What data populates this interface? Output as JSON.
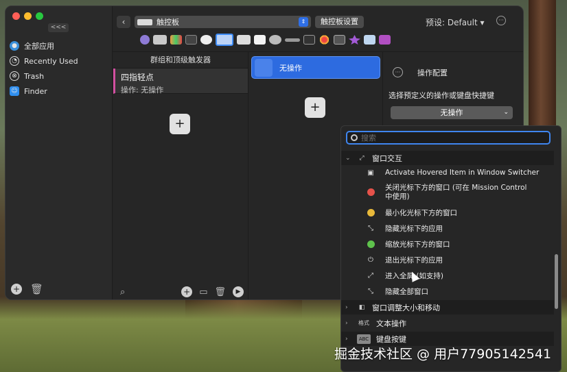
{
  "sidebar": {
    "collapse_label": "<<<",
    "items": [
      {
        "label": "全部应用",
        "icon": "globe-icon"
      },
      {
        "label": "Recently Used",
        "icon": "clock-icon"
      },
      {
        "label": "Trash",
        "icon": "trash-icon"
      },
      {
        "label": "Finder",
        "icon": "finder-icon"
      }
    ]
  },
  "toolbar": {
    "device_label": "触控板",
    "settings_label": "触控板设置",
    "preset_label": "预设: Default ▾"
  },
  "columns": {
    "triggers_header": "群组和顶级触发器",
    "trigger_title": "四指轻点",
    "trigger_subtitle": "操作: 无操作",
    "action_label": "无操作",
    "config_title": "操作配置",
    "config_subtitle": "选择预定义的操作或键盘快捷键",
    "config_select": "无操作"
  },
  "dropdown": {
    "search_placeholder": "搜索",
    "group_window_interaction": "窗口交互",
    "options": [
      {
        "label": "Activate Hovered Item in Window Switcher",
        "icon": "window-switcher-icon"
      },
      {
        "label": "关闭光标下方的窗口 (可在 Mission Control 中使用)",
        "icon": "red-dot-icon"
      },
      {
        "label": "最小化光标下方的窗口",
        "icon": "yellow-dot-icon"
      },
      {
        "label": "隐藏光标下的应用",
        "icon": "collapse-arrows-icon"
      },
      {
        "label": "缩放光标下方的窗口",
        "icon": "green-dot-icon"
      },
      {
        "label": "退出光标下的应用",
        "icon": "power-icon"
      },
      {
        "label": "进入全屏 (如支持)",
        "icon": "expand-arrows-icon"
      },
      {
        "label": "隐藏全部窗口",
        "icon": "collapse-arrows-icon"
      }
    ],
    "group_resize_move": "窗口调整大小和移动",
    "group_text_prefix": "格式",
    "group_text": "文本操作",
    "group_keys_prefix": "ABC",
    "group_keys": "键盘按键"
  },
  "watermark": "掘金技术社区 @ 用户77905142541",
  "colors": {
    "accent": "#3e8cf6",
    "trigger_marker": "#d24fa0",
    "close_red": "#e5524a",
    "minimize_yellow": "#e8b93a",
    "zoom_green": "#5ec24c"
  }
}
